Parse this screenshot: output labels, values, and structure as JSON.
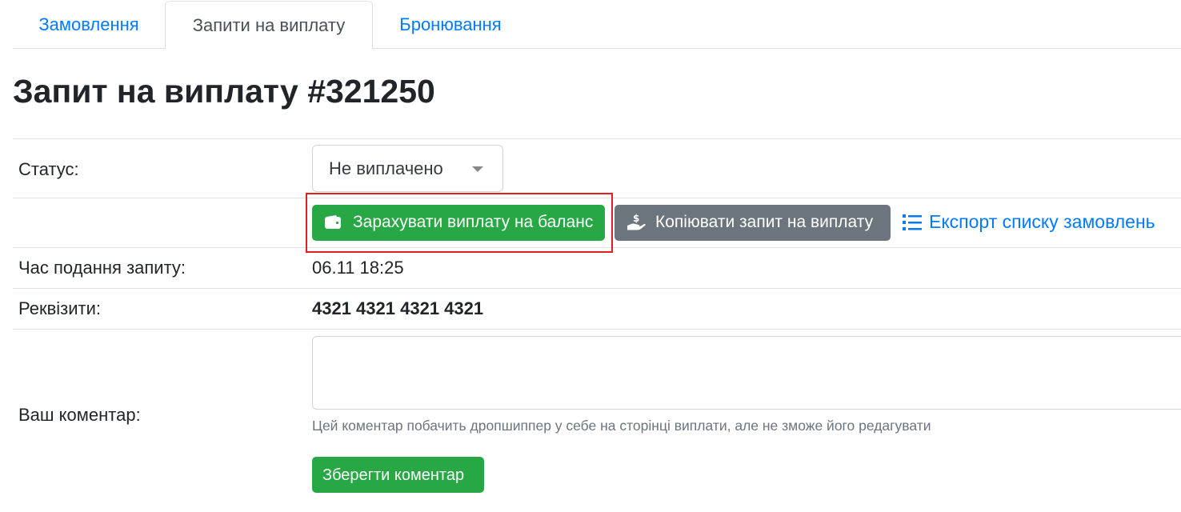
{
  "tabs": [
    {
      "label": "Замовлення",
      "active": false
    },
    {
      "label": "Запити на виплату",
      "active": true
    },
    {
      "label": "Бронювання",
      "active": false
    }
  ],
  "page": {
    "title": "Запит на виплату #321250"
  },
  "status": {
    "label": "Статус:",
    "selected": "Не виплачено"
  },
  "actions": {
    "credit_balance": {
      "label": "Зарахувати виплату на баланс",
      "icon": "wallet-icon",
      "color": "#28a745"
    },
    "copy_request": {
      "label": "Копіювати запит на виплату",
      "icon": "hand-money-icon",
      "color": "#6c757d"
    },
    "export_orders": {
      "label": "Експорт списку замовлень",
      "icon": "list-icon",
      "color": "#007bff"
    }
  },
  "details": {
    "submitted_label": "Час подання запиту:",
    "submitted_value": "06.11 18:25",
    "requisites_label": "Реквізити:",
    "requisites_value": "4321 4321 4321 4321"
  },
  "comment": {
    "label": "Ваш коментар:",
    "value": "",
    "help": "Цей коментар побачить дропшиппер у себе на сторінці виплати, але не зможе його редагувати",
    "save_label": "Зберегти коментар"
  },
  "colors": {
    "accent": "#007bff",
    "success": "#28a745",
    "highlight": "#e02020"
  }
}
